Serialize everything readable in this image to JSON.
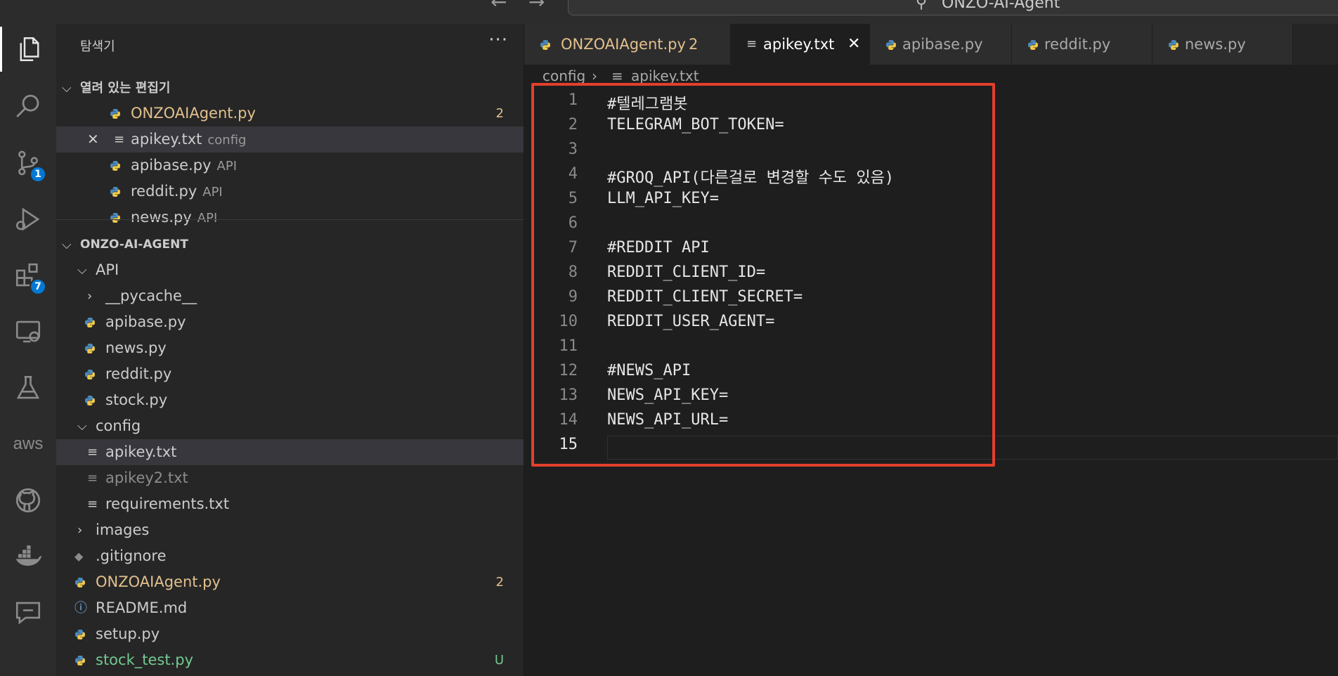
{
  "titlebar": {
    "back": "←",
    "forward": "→",
    "title": "ONZO-AI-Agent"
  },
  "activity": {
    "scm_badge": "1",
    "ext_badge": "7",
    "aws_label": "aws"
  },
  "sidebar": {
    "title": "탐색기",
    "more": "···",
    "open_editors_header": "열려 있는 편집기",
    "open_editors": [
      {
        "label": "ONZOAIAgent.py",
        "desc": "",
        "count": "2"
      },
      {
        "label": "apikey.txt",
        "desc": "config",
        "count": ""
      },
      {
        "label": "apibase.py",
        "desc": "API",
        "count": ""
      },
      {
        "label": "reddit.py",
        "desc": "API",
        "count": ""
      },
      {
        "label": "news.py",
        "desc": "API",
        "count": ""
      }
    ],
    "project_header": "ONZO-AI-AGENT",
    "tree": {
      "api_folder": "API",
      "pycache": "__pycache__",
      "apibase": "apibase.py",
      "news": "news.py",
      "reddit": "reddit.py",
      "stock": "stock.py",
      "config_folder": "config",
      "apikey": "apikey.txt",
      "apikey2": "apikey2.txt",
      "requirements": "requirements.txt",
      "images": "images",
      "gitignore": ".gitignore",
      "agent": "ONZOAIAgent.py",
      "agent_count": "2",
      "readme": "README.md",
      "setup": "setup.py",
      "stock_test": "stock_test.py",
      "stock_test_status": "U"
    }
  },
  "tabs": [
    {
      "label": "ONZOAIAgent.py",
      "count": "2"
    },
    {
      "label": "apikey.txt",
      "close": "✕"
    },
    {
      "label": "apibase.py"
    },
    {
      "label": "reddit.py"
    },
    {
      "label": "news.py"
    }
  ],
  "breadcrumb": {
    "folder": "config",
    "sep": "›",
    "file": "apikey.txt"
  },
  "editor": {
    "lines": [
      {
        "n": "1",
        "text": "#텔레그램봇"
      },
      {
        "n": "2",
        "text": "TELEGRAM_BOT_TOKEN="
      },
      {
        "n": "3",
        "text": ""
      },
      {
        "n": "4",
        "text": "#GROQ_API(다른걸로 변경할 수도 있음)"
      },
      {
        "n": "5",
        "text": "LLM_API_KEY="
      },
      {
        "n": "6",
        "text": ""
      },
      {
        "n": "7",
        "text": "#REDDIT API"
      },
      {
        "n": "8",
        "text": "REDDIT_CLIENT_ID="
      },
      {
        "n": "9",
        "text": "REDDIT_CLIENT_SECRET="
      },
      {
        "n": "10",
        "text": "REDDIT_USER_AGENT="
      },
      {
        "n": "11",
        "text": ""
      },
      {
        "n": "12",
        "text": "#NEWS_API"
      },
      {
        "n": "13",
        "text": "NEWS_API_KEY="
      },
      {
        "n": "14",
        "text": "NEWS_API_URL="
      },
      {
        "n": "15",
        "text": ""
      }
    ],
    "current_line": "15"
  },
  "colors": {
    "accent": "#0078d4",
    "highlight_box": "#e2402c",
    "modified": "#e2c08d",
    "untracked": "#73c991"
  }
}
